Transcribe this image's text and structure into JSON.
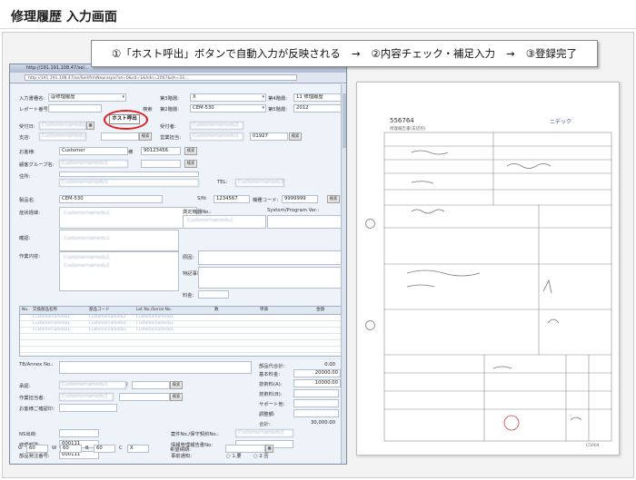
{
  "page": {
    "title": "修理履歴 入力画面"
  },
  "callout": {
    "step1": "①「ホスト呼出」ボタンで自動入力が反映される",
    "arrow": "→",
    "step2": "②内容チェック・補足入力",
    "step3": "③登録完了"
  },
  "browser": {
    "title": "http://191.191.108.47/se/...",
    "url": "http://191.191.108.47/se/Sell/frmNew.aspx?se=0&sd=1&hdn=2007&dn=33..."
  },
  "form": {
    "input_form_label": "入力書種名:",
    "input_form_value": "@修理履歴",
    "report_no_label": "レポート番号:",
    "host_button": "ホスト呼出",
    "search_button": "検索",
    "class3_label": "第3階層:",
    "class3_value": "X",
    "class4_label": "第4階層:",
    "class4_value": "11 修理履歴",
    "class2_label": "第2階層:",
    "class2_value": "CEM-530",
    "class5_label": "第5階層:",
    "class5_value": "2012",
    "received_date_label": "受付日:",
    "received_by_label": "受付者:",
    "branch_label": "支店:",
    "sales_dept_label": "営業担当:",
    "sales_code": "01927",
    "customer_label": "お客様:",
    "customer_value": "Customer",
    "customer_suffix": "様",
    "customer_code": "90123456",
    "group_label": "顧客グループ名:",
    "address_label": "住所:",
    "tel_label": "TEL:",
    "product_label": "製品名:",
    "product_value": "CEM-530",
    "sn_label": "S/N:",
    "sn_value": "1234567",
    "model_code_label": "機種コード:",
    "model_code_value": "9999999",
    "symptom_label": "症状経緯:",
    "measure_label": "測定機器No.:",
    "system_label": "System/Program Ver.:",
    "confirm_label": "確認:",
    "work_label": "作業内容:",
    "cause_label": "原因:",
    "special_label": "特記事項:",
    "fee_label": "料金:",
    "blur_text": "Customernamedu1"
  },
  "parts": {
    "columns": [
      "No.",
      "交換部品名称",
      "部品コード",
      "Lot No./Serial No.",
      "数",
      "単価",
      "金額"
    ],
    "row_text": "Customernamedu1",
    "row_count": 7
  },
  "totals": {
    "tb_annex_label": "TB/Annex No.:",
    "parts_total_label": "部品代合計:",
    "parts_total_value": "0.00",
    "basic_fee_label": "基本料金:",
    "basic_fee_value": "20000.00",
    "tech_fee_a_label": "技術料(A):",
    "tech_fee_a_value": "10000.00",
    "tech_fee_b_label": "技術料(B):",
    "support_label": "サポート他:",
    "adjust_label": "調整額:",
    "total_label": "合計:",
    "total_value": "30,000.00",
    "approver_label": "承認:",
    "worker_label": "作業担当者:",
    "confirm_person_label": "お客様ご確認印:"
  },
  "footer": {
    "ns_label": "NS出荷:",
    "repair_dept_label": "修理部署:",
    "repair_dept_value": "000111",
    "parts_order_label": "部品発注番号:",
    "parts_order_value": "000111",
    "g_label": "G",
    "g_value": "60",
    "w_label": "W",
    "w_value": "60",
    "b_label": "B",
    "b_value": "60",
    "c_label": "C",
    "c_value": "X",
    "case_no_label": "案件No./保守契約No.:",
    "info_report_label": "情報管理報告書No:",
    "notice_label": "事前通知:",
    "notice_opt1": "1.要",
    "notice_opt2": "2.否",
    "desired_label": "希望納期:"
  },
  "document": {
    "form_no": "556764",
    "company": "ニデック",
    "doc_title": "修理報告書(支店控)",
    "footer_code": "C5004"
  }
}
